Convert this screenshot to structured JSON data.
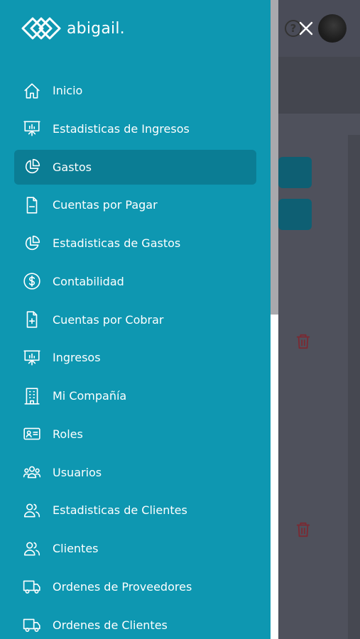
{
  "app": {
    "brand_name": "abigail."
  },
  "drawer": {
    "items": [
      {
        "label": "Inicio",
        "icon": "home-icon"
      },
      {
        "label": "Estadisticas de Ingresos",
        "icon": "presentation-chart-icon"
      },
      {
        "label": "Gastos",
        "icon": "pie-chart-icon",
        "active": true
      },
      {
        "label": "Cuentas por Pagar",
        "icon": "document-minus-icon"
      },
      {
        "label": "Estadisticas de Gastos",
        "icon": "pie-chart-icon"
      },
      {
        "label": "Contabilidad",
        "icon": "dollar-circle-icon"
      },
      {
        "label": "Cuentas por Cobrar",
        "icon": "document-plus-icon"
      },
      {
        "label": "Ingresos",
        "icon": "presentation-chart-icon"
      },
      {
        "label": "Mi Compañía",
        "icon": "building-icon"
      },
      {
        "label": "Roles",
        "icon": "id-card-icon"
      },
      {
        "label": "Usuarios",
        "icon": "user-group-icon"
      },
      {
        "label": "Estadisticas de Clientes",
        "icon": "users-icon"
      },
      {
        "label": "Clientes",
        "icon": "users-icon"
      },
      {
        "label": "Ordenes de Proveedores",
        "icon": "truck-icon"
      },
      {
        "label": "Ordenes de Clientes",
        "icon": "truck-icon"
      }
    ]
  },
  "header": {
    "help_symbol": "?"
  },
  "colors": {
    "drawer_bg": "#0e97b1",
    "active_item_bg": "#0b7d94",
    "overlay_bg": "#4b4d5a",
    "trash_red": "#7a2a33"
  }
}
